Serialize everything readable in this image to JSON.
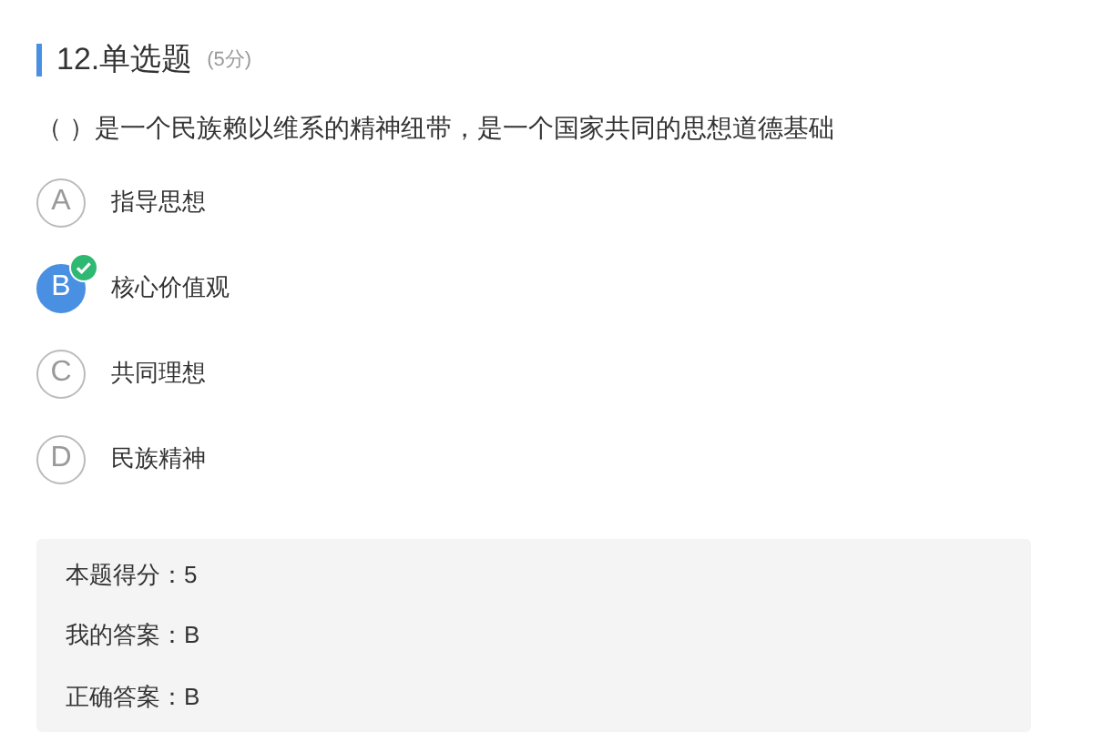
{
  "question": {
    "title": "12.单选题",
    "points": "(5分)",
    "text": "（ ）是一个民族赖以维系的精神纽带，是一个国家共同的思想道德基础"
  },
  "options": [
    {
      "letter": "A",
      "text": "指导思想",
      "selected": false
    },
    {
      "letter": "B",
      "text": "核心价值观",
      "selected": true
    },
    {
      "letter": "C",
      "text": "共同理想",
      "selected": false
    },
    {
      "letter": "D",
      "text": "民族精神",
      "selected": false
    }
  ],
  "result": [
    "本题得分：5",
    "我的答案：B",
    "正确答案：B"
  ]
}
